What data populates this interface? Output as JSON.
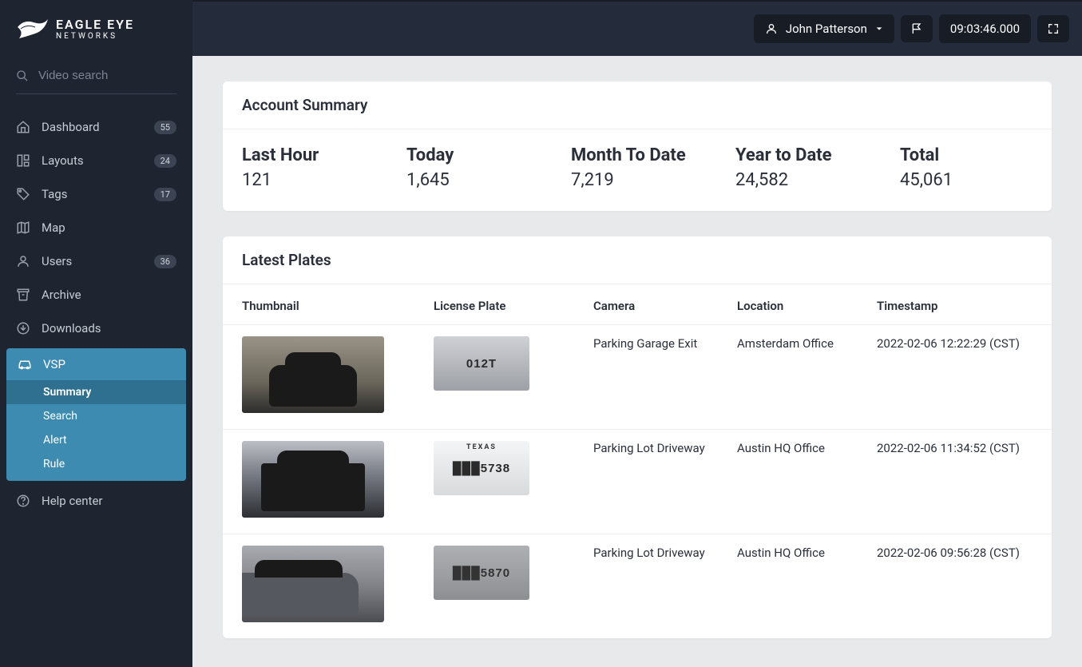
{
  "brand": {
    "line1": "EAGLE EYE",
    "line2": "NETWORKS"
  },
  "search": {
    "placeholder": "Video search"
  },
  "sidebar": {
    "items": [
      {
        "label": "Dashboard",
        "badge": "55"
      },
      {
        "label": "Layouts",
        "badge": "24"
      },
      {
        "label": "Tags",
        "badge": "17"
      },
      {
        "label": "Map"
      },
      {
        "label": "Users",
        "badge": "36"
      },
      {
        "label": "Archive"
      },
      {
        "label": "Downloads"
      }
    ],
    "vsp": {
      "label": "VSP",
      "sub": [
        {
          "label": "Summary"
        },
        {
          "label": "Search"
        },
        {
          "label": "Alert"
        },
        {
          "label": "Rule"
        }
      ]
    },
    "help": {
      "label": "Help center"
    }
  },
  "topbar": {
    "user": "John Patterson",
    "time": "09:03:46.000"
  },
  "summary": {
    "title": "Account Summary",
    "stats": [
      {
        "label": "Last Hour",
        "value": "121"
      },
      {
        "label": "Today",
        "value": "1,645"
      },
      {
        "label": "Month To Date",
        "value": "7,219"
      },
      {
        "label": "Year to Date",
        "value": "24,582"
      },
      {
        "label": "Total",
        "value": "45,061"
      }
    ]
  },
  "plates": {
    "title": "Latest Plates",
    "columns": {
      "thumb": "Thumbnail",
      "plate": "License Plate",
      "camera": "Camera",
      "location": "Location",
      "timestamp": "Timestamp"
    },
    "rows": [
      {
        "plate_text": "012T",
        "camera": "Parking Garage Exit",
        "location": "Amsterdam Office",
        "timestamp": "2022-02-06 12:22:29 (CST)"
      },
      {
        "plate_text": "███5738",
        "plate_region": "TEXAS",
        "camera": "Parking Lot Driveway",
        "location": "Austin HQ Office",
        "timestamp": "2022-02-06 11:34:52 (CST)"
      },
      {
        "plate_text": "███5870",
        "camera": "Parking Lot Driveway",
        "location": "Austin HQ Office",
        "timestamp": "2022-02-06 09:56:28 (CST)"
      }
    ]
  }
}
